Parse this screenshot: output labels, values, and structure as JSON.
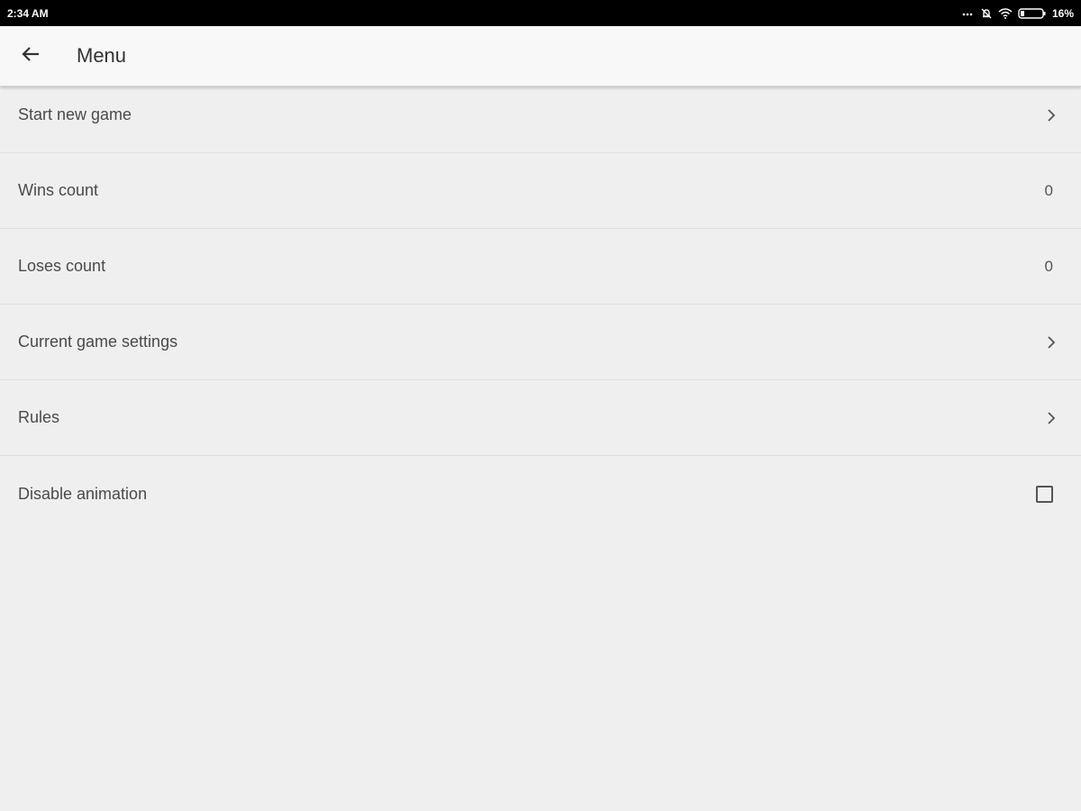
{
  "status_bar": {
    "time": "2:34 AM",
    "battery_percent": "16%",
    "icons": [
      "more-dots-icon",
      "notifications-off-icon",
      "wifi-icon",
      "battery-icon"
    ]
  },
  "app_bar": {
    "title": "Menu",
    "back_icon": "arrow-back-icon"
  },
  "menu": {
    "items": [
      {
        "label": "Start new game",
        "trailing": "chevron-right-icon"
      },
      {
        "label": "Wins count",
        "value": "0"
      },
      {
        "label": "Loses count",
        "value": "0"
      },
      {
        "label": "Current game settings",
        "trailing": "chevron-right-icon"
      },
      {
        "label": "Rules",
        "trailing": "chevron-right-icon"
      },
      {
        "label": "Disable animation",
        "trailing": "checkbox",
        "checked": false
      }
    ]
  },
  "colors": {
    "status_bar_bg": "#000000",
    "app_bar_bg": "#f8f8f8",
    "page_bg": "#efefef",
    "text": "#4a4a4a"
  }
}
